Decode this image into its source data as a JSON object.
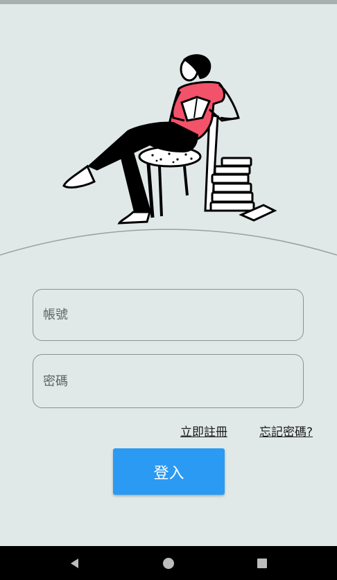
{
  "form": {
    "account_placeholder": "帳號",
    "password_placeholder": "密碼",
    "register_label": "立即註冊",
    "forgot_label": "忘記密碼?",
    "login_label": "登入"
  },
  "icons": {
    "illustration": "person-reading-in-chair-illustration",
    "nav_back": "back-triangle-icon",
    "nav_home": "home-circle-icon",
    "nav_recent": "recents-square-icon"
  },
  "colors": {
    "background": "#e1e8e8",
    "accent": "#2b9af3",
    "illustration_shirt": "#f2526a"
  }
}
